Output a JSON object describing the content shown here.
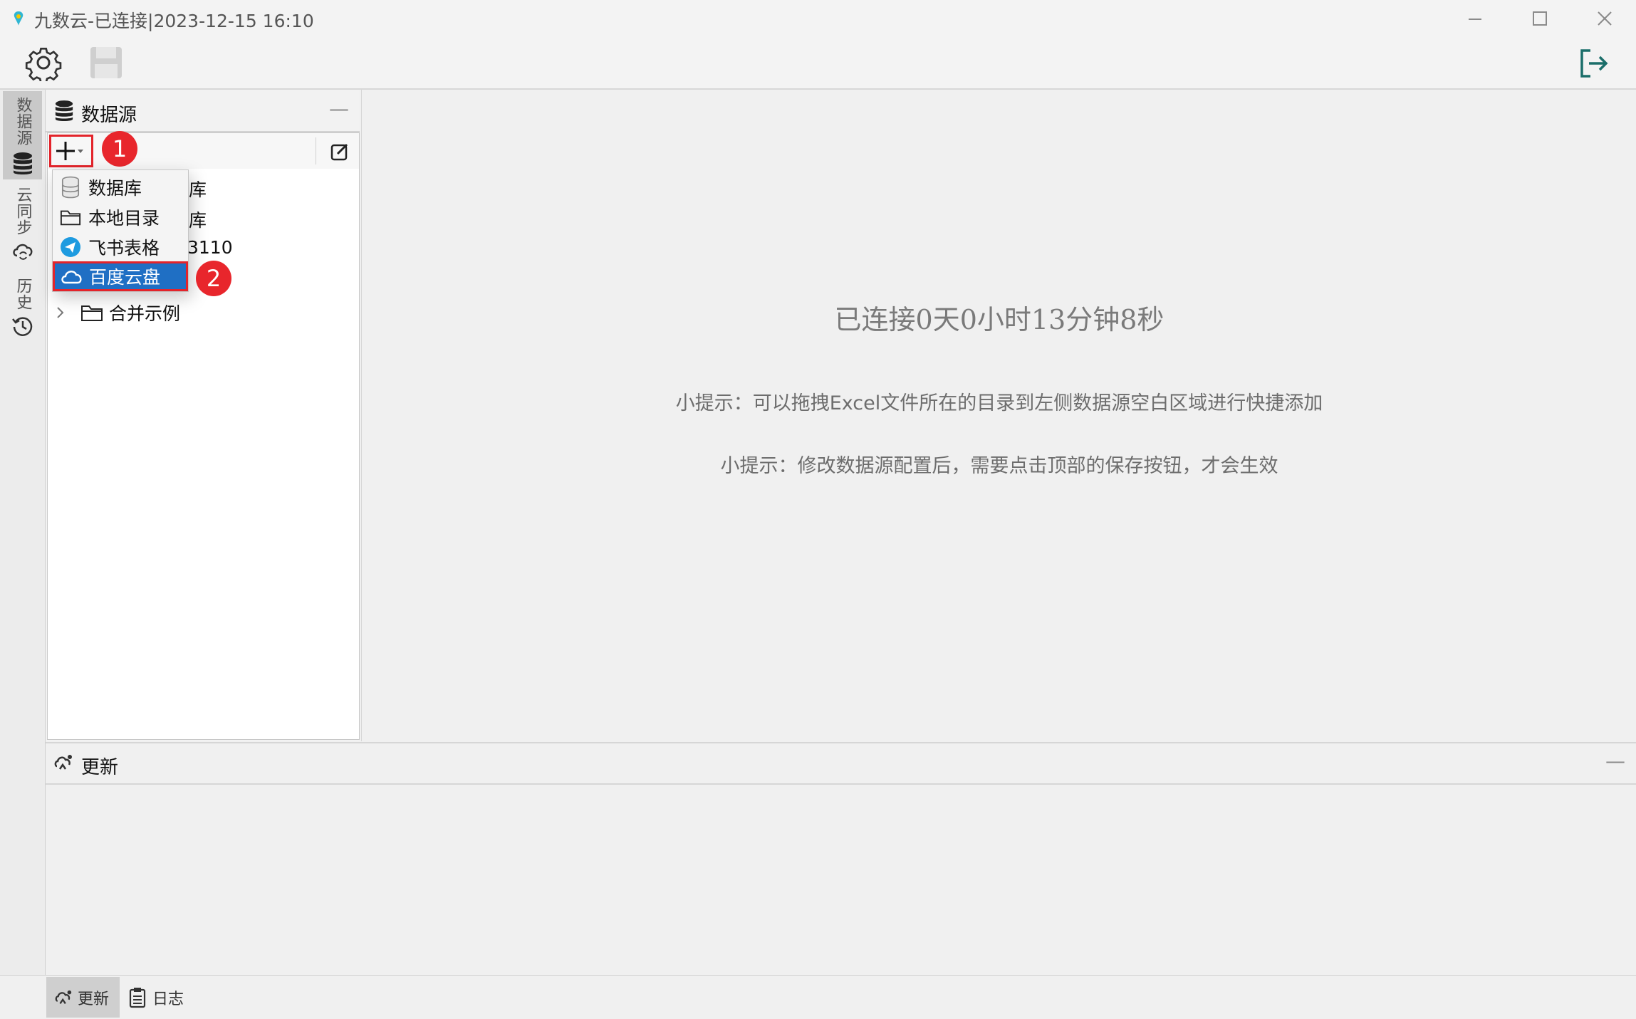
{
  "window": {
    "title": "九数云-已连接|2023-12-15 16:10"
  },
  "side_tabs": [
    {
      "label": "数据源"
    },
    {
      "label": "云同步"
    },
    {
      "label": "历史"
    }
  ],
  "datasource_panel": {
    "title": "数据源",
    "minimize": "—",
    "tree_partial": [
      {
        "text": "库"
      },
      {
        "text": "库"
      },
      {
        "text": "3110"
      }
    ],
    "tree_group": {
      "label": "合并示例"
    }
  },
  "add_menu": {
    "items": [
      {
        "label": "数据库",
        "icon": "database-icon"
      },
      {
        "label": "本地目录",
        "icon": "folder-icon"
      },
      {
        "label": "飞书表格",
        "icon": "feishu-icon"
      },
      {
        "label": "百度云盘",
        "icon": "cloud-icon",
        "selected": true
      }
    ]
  },
  "annotations": {
    "badge1": "1",
    "badge2": "2",
    "color": "#e8262c"
  },
  "main": {
    "connection_time": "已连接0天0小时13分钟8秒",
    "tip1": "小提示：可以拖拽Excel文件所在的目录到左侧数据源空白区域进行快捷添加",
    "tip2": "小提示：修改数据源配置后，需要点击顶部的保存按钮，才会生效"
  },
  "update_panel": {
    "title": "更新",
    "minimize": "—"
  },
  "bottom_tabs": [
    {
      "label": "更新",
      "active": true
    },
    {
      "label": "日志"
    }
  ],
  "colors": {
    "accent": "#1f6fc4",
    "logout": "#1b6e6a"
  }
}
